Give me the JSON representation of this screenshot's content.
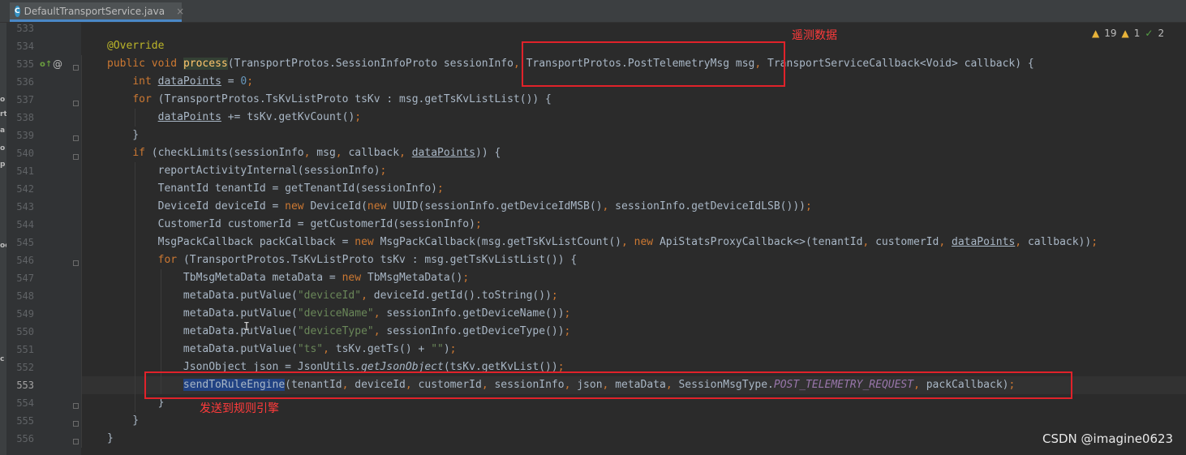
{
  "tab": {
    "icon_letter": "C",
    "title": "DefaultTransportService.java",
    "close": "×"
  },
  "left_strip": [
    "o",
    "rt",
    "a",
    "o",
    "p",
    "oc",
    "c"
  ],
  "inspections": {
    "warnings": "19",
    "weak": "1",
    "ok": "2"
  },
  "gutter": {
    "override_icon": "o↑",
    "at_icon": "@"
  },
  "line_numbers": [
    "533",
    "534",
    "535",
    "536",
    "537",
    "538",
    "539",
    "540",
    "541",
    "542",
    "543",
    "544",
    "545",
    "546",
    "547",
    "548",
    "549",
    "550",
    "551",
    "552",
    "553",
    "554",
    "555",
    "556"
  ],
  "code": [
    [
      {
        "t": "@Override",
        "c": "ann"
      }
    ],
    [
      {
        "t": "public ",
        "c": "kw"
      },
      {
        "t": "void ",
        "c": "kw"
      },
      {
        "t": "process",
        "c": "meth-hl"
      },
      {
        "t": "(TransportProtos.SessionInfoProto sessionInfo"
      },
      {
        "t": ", ",
        "c": "kw"
      },
      {
        "t": "TransportProtos.PostTelemetryMsg msg"
      },
      {
        "t": ", ",
        "c": "kw"
      },
      {
        "t": "TransportServiceCallback<Void> callback) {"
      }
    ],
    [
      {
        "t": "    "
      },
      {
        "t": "int ",
        "c": "kw"
      },
      {
        "t": "dataPoints",
        "c": "ul"
      },
      {
        "t": " = "
      },
      {
        "t": "0",
        "c": "num"
      },
      {
        "t": ";",
        "c": "kw"
      }
    ],
    [
      {
        "t": "    "
      },
      {
        "t": "for ",
        "c": "kw"
      },
      {
        "t": "(TransportProtos.TsKvListProto tsKv : msg.getTsKvListList()) {"
      }
    ],
    [
      {
        "t": "        "
      },
      {
        "t": "dataPoints",
        "c": "ul"
      },
      {
        "t": " += tsKv.getKvCount()"
      },
      {
        "t": ";",
        "c": "kw"
      }
    ],
    [
      {
        "t": "    }"
      }
    ],
    [
      {
        "t": "    "
      },
      {
        "t": "if ",
        "c": "kw"
      },
      {
        "t": "(checkLimits(sessionInfo"
      },
      {
        "t": ", ",
        "c": "kw"
      },
      {
        "t": "msg"
      },
      {
        "t": ", ",
        "c": "kw"
      },
      {
        "t": "callback"
      },
      {
        "t": ", ",
        "c": "kw"
      },
      {
        "t": "dataPoints",
        "c": "ul"
      },
      {
        "t": ")) {"
      }
    ],
    [
      {
        "t": "        reportActivityInternal(sessionInfo)"
      },
      {
        "t": ";",
        "c": "kw"
      }
    ],
    [
      {
        "t": "        TenantId tenantId = getTenantId(sessionInfo)"
      },
      {
        "t": ";",
        "c": "kw"
      }
    ],
    [
      {
        "t": "        DeviceId deviceId = "
      },
      {
        "t": "new ",
        "c": "kw"
      },
      {
        "t": "DeviceId("
      },
      {
        "t": "new ",
        "c": "kw"
      },
      {
        "t": "UUID(sessionInfo.getDeviceIdMSB()"
      },
      {
        "t": ", ",
        "c": "kw"
      },
      {
        "t": "sessionInfo.getDeviceIdLSB()))"
      },
      {
        "t": ";",
        "c": "kw"
      }
    ],
    [
      {
        "t": "        CustomerId customerId = getCustomerId(sessionInfo)"
      },
      {
        "t": ";",
        "c": "kw"
      }
    ],
    [
      {
        "t": "        MsgPackCallback packCallback = "
      },
      {
        "t": "new ",
        "c": "kw"
      },
      {
        "t": "MsgPackCallback(msg.getTsKvListCount()"
      },
      {
        "t": ", ",
        "c": "kw"
      },
      {
        "t": "new ",
        "c": "kw"
      },
      {
        "t": "ApiStatsProxyCallback<>(tenantId"
      },
      {
        "t": ", ",
        "c": "kw"
      },
      {
        "t": "customerId"
      },
      {
        "t": ", ",
        "c": "kw"
      },
      {
        "t": "dataPoints",
        "c": "ul"
      },
      {
        "t": ", ",
        "c": "kw"
      },
      {
        "t": "callback))"
      },
      {
        "t": ";",
        "c": "kw"
      }
    ],
    [
      {
        "t": "        "
      },
      {
        "t": "for ",
        "c": "kw"
      },
      {
        "t": "(TransportProtos.TsKvListProto tsKv : msg.getTsKvListList()) {"
      }
    ],
    [
      {
        "t": "            TbMsgMetaData metaData = "
      },
      {
        "t": "new ",
        "c": "kw"
      },
      {
        "t": "TbMsgMetaData()"
      },
      {
        "t": ";",
        "c": "kw"
      }
    ],
    [
      {
        "t": "            metaData.putValue("
      },
      {
        "t": "\"deviceId\"",
        "c": "str"
      },
      {
        "t": ", ",
        "c": "kw"
      },
      {
        "t": "deviceId.getId().toString())"
      },
      {
        "t": ";",
        "c": "kw"
      }
    ],
    [
      {
        "t": "            metaData.putValue("
      },
      {
        "t": "\"deviceName\"",
        "c": "str"
      },
      {
        "t": ", ",
        "c": "kw"
      },
      {
        "t": "sessionInfo.getDeviceName())"
      },
      {
        "t": ";",
        "c": "kw"
      }
    ],
    [
      {
        "t": "            metaData.putValue("
      },
      {
        "t": "\"deviceType\"",
        "c": "str"
      },
      {
        "t": ", ",
        "c": "kw"
      },
      {
        "t": "sessionInfo.getDeviceType())"
      },
      {
        "t": ";",
        "c": "kw"
      }
    ],
    [
      {
        "t": "            metaData.putValue("
      },
      {
        "t": "\"ts\"",
        "c": "str"
      },
      {
        "t": ", ",
        "c": "kw"
      },
      {
        "t": "tsKv.getTs() + "
      },
      {
        "t": "\"\"",
        "c": "str"
      },
      {
        "t": ")"
      },
      {
        "t": ";",
        "c": "kw"
      }
    ],
    [
      {
        "t": "            JsonObject json = JsonUtils."
      },
      {
        "t": "getJsonObject",
        "c": "italic"
      },
      {
        "t": "(tsKv.getKvList())"
      },
      {
        "t": ";",
        "c": "kw"
      }
    ],
    [
      {
        "t": "            "
      },
      {
        "t": "sendToRuleEngine",
        "c": "sel"
      },
      {
        "t": "(tenantId"
      },
      {
        "t": ", ",
        "c": "kw"
      },
      {
        "t": "deviceId"
      },
      {
        "t": ", ",
        "c": "kw"
      },
      {
        "t": "customerId"
      },
      {
        "t": ", ",
        "c": "kw"
      },
      {
        "t": "sessionInfo"
      },
      {
        "t": ", ",
        "c": "kw"
      },
      {
        "t": "json"
      },
      {
        "t": ", ",
        "c": "kw"
      },
      {
        "t": "metaData"
      },
      {
        "t": ", ",
        "c": "kw"
      },
      {
        "t": "SessionMsgType."
      },
      {
        "t": "POST_TELEMETRY_REQUEST",
        "c": "field italic"
      },
      {
        "t": ", ",
        "c": "kw"
      },
      {
        "t": "packCallback)"
      },
      {
        "t": ";",
        "c": "kw"
      }
    ],
    [
      {
        "t": "        }"
      }
    ],
    [
      {
        "t": "    }"
      }
    ],
    [
      {
        "t": "}"
      }
    ]
  ],
  "annotations": {
    "telemetry_label": "遥测数据",
    "rule_engine_label": "发送到规则引擎"
  },
  "watermark": "CSDN @imagine0623"
}
